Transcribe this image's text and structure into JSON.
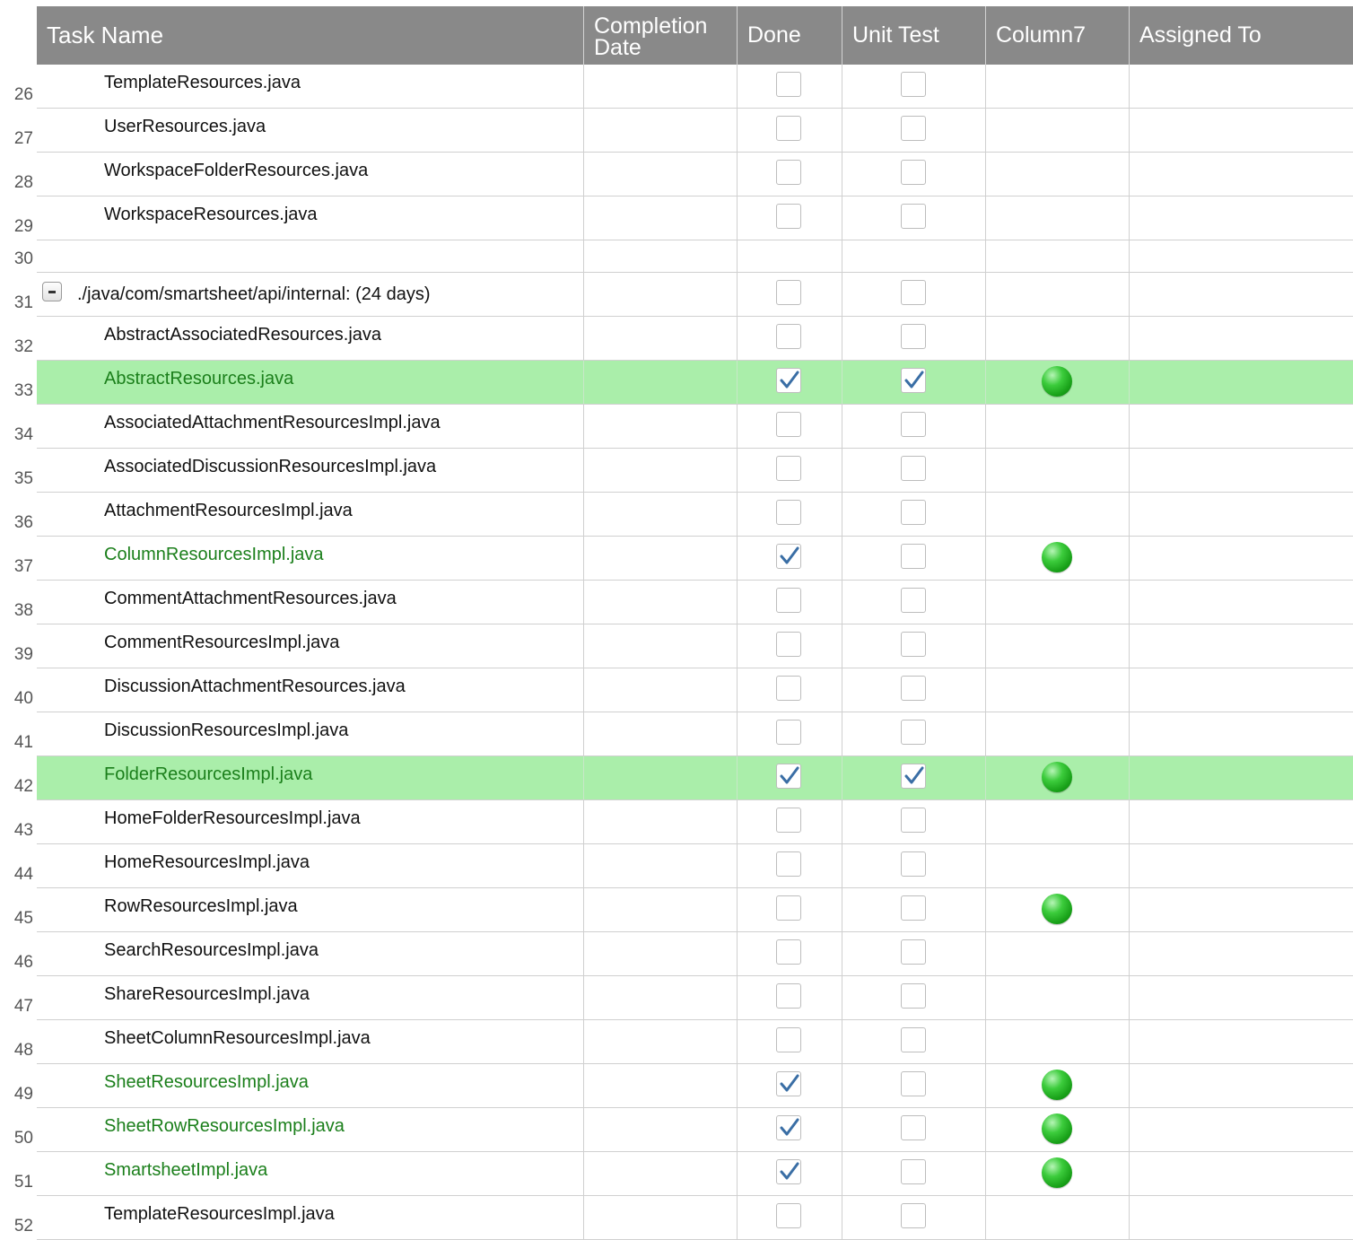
{
  "colors": {
    "header_bg": "#898989",
    "highlight": "#aaeeaa",
    "done_text": "#1b7f1b",
    "status_dot": "#22aa22",
    "check": "#3a6ea5"
  },
  "columns": [
    {
      "key": "task",
      "label": "Task Name"
    },
    {
      "key": "date",
      "label": "Completion\nDate"
    },
    {
      "key": "done",
      "label": "Done"
    },
    {
      "key": "unit",
      "label": "Unit Test"
    },
    {
      "key": "col7",
      "label": "Column7"
    },
    {
      "key": "assigned",
      "label": "Assigned To"
    }
  ],
  "rows": [
    {
      "num": "26",
      "task": "TemplateResources.java",
      "done": false,
      "unit": false,
      "status": false
    },
    {
      "num": "27",
      "task": "UserResources.java",
      "done": false,
      "unit": false,
      "status": false
    },
    {
      "num": "28",
      "task": "WorkspaceFolderResources.java",
      "done": false,
      "unit": false,
      "status": false
    },
    {
      "num": "29",
      "task": "WorkspaceResources.java",
      "done": false,
      "unit": false,
      "status": false
    },
    {
      "num": "30",
      "task": "",
      "blank": true
    },
    {
      "num": "31",
      "task": "./java/com/smartsheet/api/internal: (24 days)",
      "parent": true,
      "done": false,
      "unit": false,
      "status": false
    },
    {
      "num": "32",
      "task": "AbstractAssociatedResources.java",
      "done": false,
      "unit": false,
      "status": false
    },
    {
      "num": "33",
      "task": "AbstractResources.java",
      "done": true,
      "unit": true,
      "status": true
    },
    {
      "num": "34",
      "task": "AssociatedAttachmentResourcesImpl.java",
      "done": false,
      "unit": false,
      "status": false
    },
    {
      "num": "35",
      "task": "AssociatedDiscussionResourcesImpl.java",
      "done": false,
      "unit": false,
      "status": false
    },
    {
      "num": "36",
      "task": "AttachmentResourcesImpl.java",
      "done": false,
      "unit": false,
      "status": false
    },
    {
      "num": "37",
      "task": "ColumnResourcesImpl.java",
      "done": true,
      "unit": false,
      "status": true
    },
    {
      "num": "38",
      "task": "CommentAttachmentResources.java",
      "done": false,
      "unit": false,
      "status": false
    },
    {
      "num": "39",
      "task": "CommentResourcesImpl.java",
      "done": false,
      "unit": false,
      "status": false
    },
    {
      "num": "40",
      "task": "DiscussionAttachmentResources.java",
      "done": false,
      "unit": false,
      "status": false
    },
    {
      "num": "41",
      "task": "DiscussionResourcesImpl.java",
      "done": false,
      "unit": false,
      "status": false
    },
    {
      "num": "42",
      "task": "FolderResourcesImpl.java",
      "done": true,
      "unit": true,
      "status": true
    },
    {
      "num": "43",
      "task": "HomeFolderResourcesImpl.java",
      "done": false,
      "unit": false,
      "status": false
    },
    {
      "num": "44",
      "task": "HomeResourcesImpl.java",
      "done": false,
      "unit": false,
      "status": false
    },
    {
      "num": "45",
      "task": "RowResourcesImpl.java",
      "done": false,
      "unit": false,
      "status": true
    },
    {
      "num": "46",
      "task": "SearchResourcesImpl.java",
      "done": false,
      "unit": false,
      "status": false
    },
    {
      "num": "47",
      "task": "ShareResourcesImpl.java",
      "done": false,
      "unit": false,
      "status": false
    },
    {
      "num": "48",
      "task": "SheetColumnResourcesImpl.java",
      "done": false,
      "unit": false,
      "status": false
    },
    {
      "num": "49",
      "task": "SheetResourcesImpl.java",
      "done": true,
      "unit": false,
      "status": true
    },
    {
      "num": "50",
      "task": "SheetRowResourcesImpl.java",
      "done": true,
      "unit": false,
      "status": true
    },
    {
      "num": "51",
      "task": "SmartsheetImpl.java",
      "done": true,
      "unit": false,
      "status": true
    },
    {
      "num": "52",
      "task": "TemplateResourcesImpl.java",
      "done": false,
      "unit": false,
      "status": false
    }
  ]
}
